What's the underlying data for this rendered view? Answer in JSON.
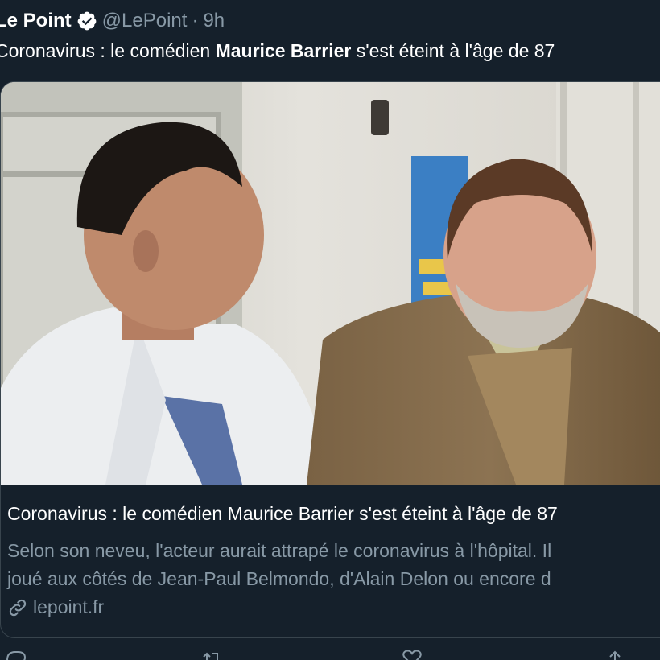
{
  "tweet": {
    "display_name": "Le Point",
    "handle": "@LePoint",
    "separator": "·",
    "time": "9h",
    "text_before": "Coronavirus : le comédien ",
    "text_bold": "Maurice Barrier",
    "text_after": " s'est éteint à l'âge de 87"
  },
  "card": {
    "title": "Coronavirus : le comédien Maurice Barrier s'est éteint à l'âge de 87",
    "description_line1": "Selon son neveu, l'acteur aurait attrapé le coronavirus à l'hôpital. Il",
    "description_line2": "joué aux côtés de Jean-Paul Belmondo, d'Alain Delon ou encore d",
    "domain": "lepoint.fr"
  },
  "actions": [
    {
      "icon": "reply-icon"
    },
    {
      "icon": "retweet-icon"
    },
    {
      "icon": "like-icon"
    },
    {
      "icon": "share-icon"
    }
  ],
  "colors": {
    "background": "#15202b",
    "secondary_text": "#8899a6",
    "border": "#38444d",
    "verified": "#ffffff"
  }
}
